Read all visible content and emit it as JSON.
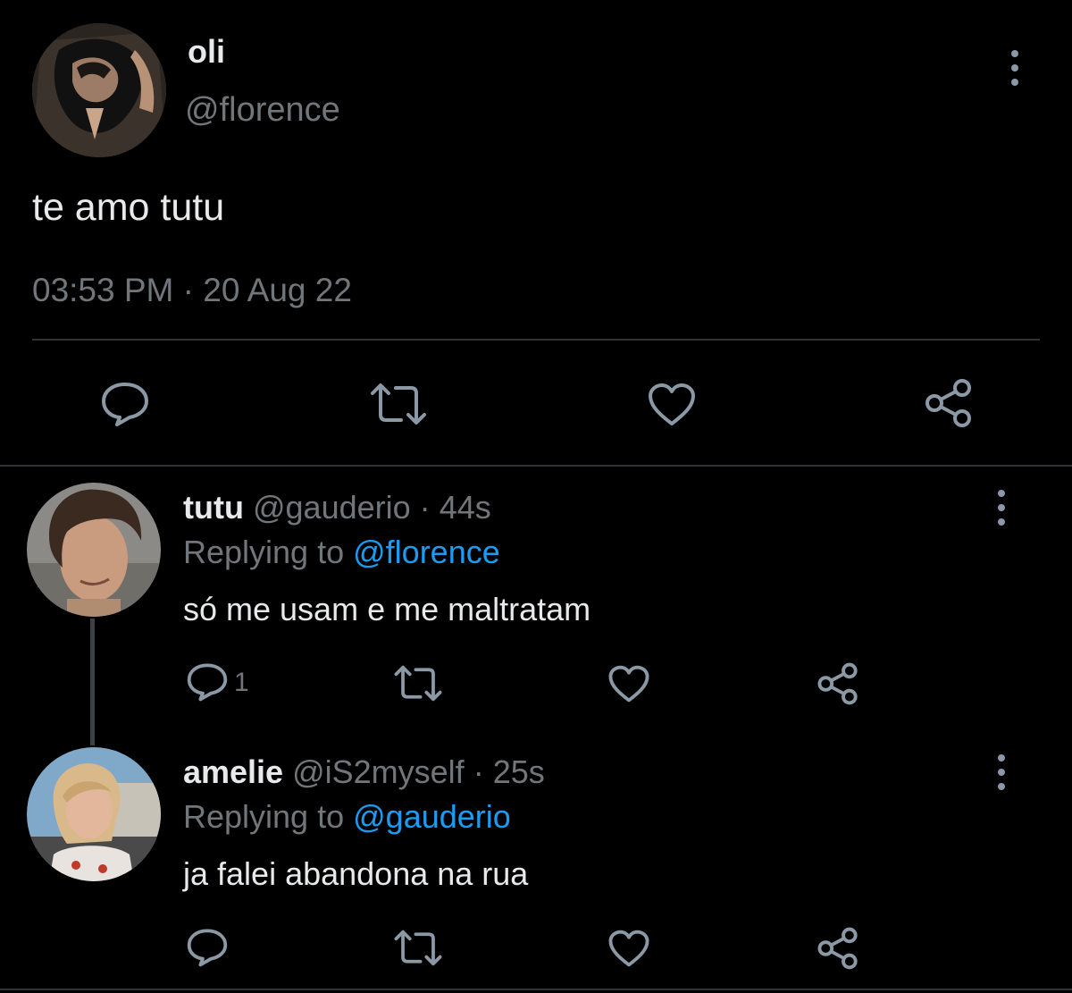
{
  "main_tweet": {
    "author_name": "oli",
    "author_handle": "@florence",
    "text": "te amo tutu",
    "time": "03:53 PM",
    "separator": "·",
    "date": "20 Aug 22",
    "actions": [
      "reply-icon",
      "retweet-icon",
      "like-icon",
      "share-icon"
    ]
  },
  "replies": [
    {
      "author_name": "tutu",
      "author_handle": "@gauderio",
      "separator": "·",
      "age": "44s",
      "replying_prefix": "Replying to",
      "replying_to": "@florence",
      "text": "só me usam e me maltratam",
      "reply_count": "1"
    },
    {
      "author_name": "amelie",
      "author_handle": "@iS2myself",
      "separator": "·",
      "age": "25s",
      "replying_prefix": "Replying to",
      "replying_to": "@gauderio",
      "text": "ja falei abandona na rua",
      "reply_count": ""
    }
  ],
  "colors": {
    "background": "#000000",
    "text_primary": "#e7e9ea",
    "text_secondary": "#71767b",
    "link": "#1d9bf0",
    "divider": "#2f3336"
  }
}
